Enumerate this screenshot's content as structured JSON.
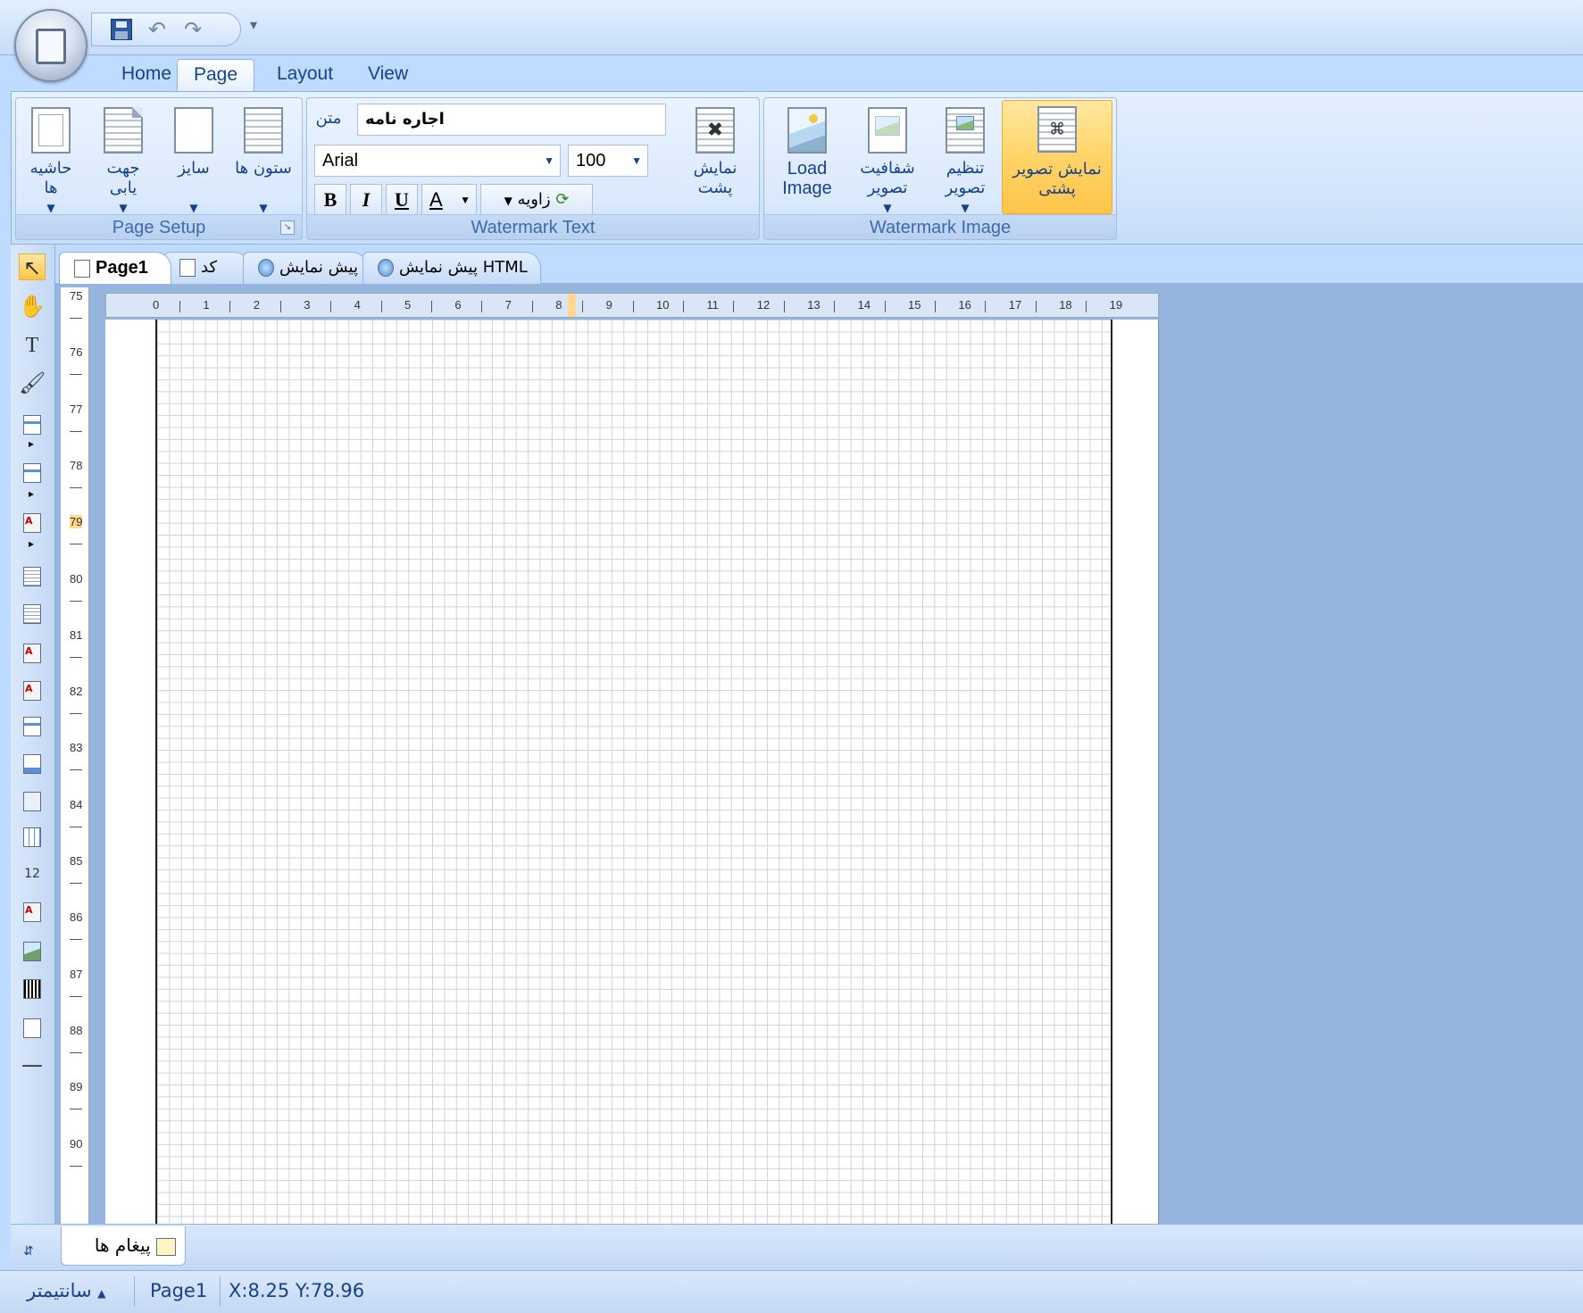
{
  "qat": {
    "undo_icon": "undo-icon",
    "redo_icon": "redo-icon",
    "more": "▾"
  },
  "ribbon_tabs": [
    "Home",
    "Page",
    "Layout",
    "View"
  ],
  "active_tab": "Page",
  "page_setup": {
    "label": "Page Setup",
    "margins": "حاشیه ها",
    "orientation": "جهت یابی",
    "size": "سایز",
    "columns": "ستون ها"
  },
  "watermark_text": {
    "label": "Watermark Text",
    "text_label": "متن",
    "text_value": "اجاره نامه",
    "font": "Arial",
    "font_size": "100",
    "bold": "B",
    "italic": "I",
    "underline": "U",
    "color": "A",
    "angle": "زاویه",
    "show_behind": "نمایش پشت"
  },
  "watermark_image": {
    "label": "Watermark Image",
    "load_image": "Load Image",
    "transparency": "شفافیت تصویر",
    "image_setting": "تنظیم تصویر",
    "show_background": "نمایش تصویر پشتی"
  },
  "doc_tabs": [
    "Page1",
    "کد",
    "پیش نمایش",
    "پیش نمایش HTML"
  ],
  "vruler": [
    "75",
    "76",
    "77",
    "78",
    "79",
    "80",
    "81",
    "82",
    "83",
    "84",
    "85",
    "86",
    "87",
    "88",
    "89",
    "90"
  ],
  "hruler": [
    "0",
    "1",
    "2",
    "3",
    "4",
    "5",
    "6",
    "7",
    "8",
    "9",
    "10",
    "11",
    "12",
    "13",
    "14",
    "15",
    "16",
    "17",
    "18",
    "19"
  ],
  "messages_tab": "پیغام ها",
  "status": {
    "unit": "سانتیمتر",
    "page": "Page1",
    "coords": "X:8.25  Y:78.96"
  },
  "colors": {
    "ribbon_bg": "#dbe9fd",
    "highlight": "#ffc44a",
    "text": "#15428b"
  }
}
